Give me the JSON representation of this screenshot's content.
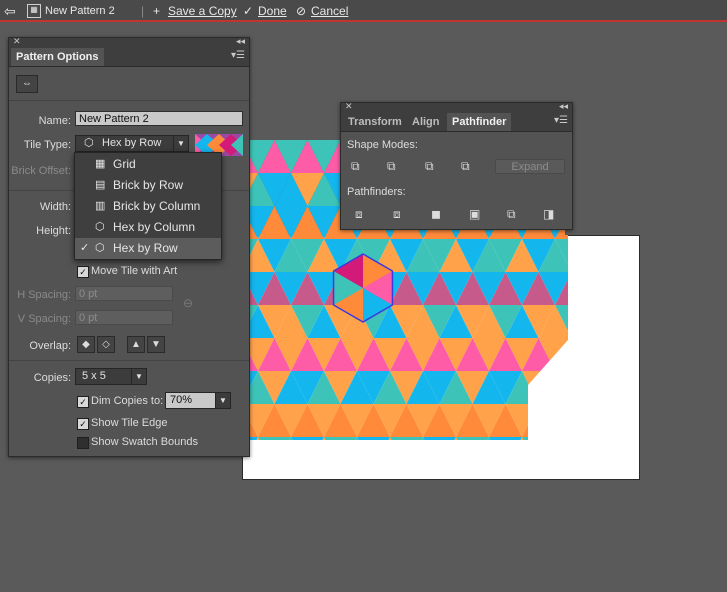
{
  "topbar": {
    "doc_name": "New Pattern 2",
    "save_copy": "Save a Copy",
    "done": "Done",
    "cancel": "Cancel",
    "back_icon": "back-arrow-icon",
    "accent": "#c1342f"
  },
  "pattern_options": {
    "title": "Pattern Options",
    "name_label": "Name:",
    "name_value": "New Pattern 2",
    "tile_type_label": "Tile Type:",
    "tile_type_value": "Hex by Row",
    "brick_offset_label": "Brick Offset:",
    "width_label": "Width:",
    "height_label": "Height:",
    "move_tile": "Move Tile with Art",
    "h_spacing_label": "H Spacing:",
    "h_spacing_value": "0 pt",
    "v_spacing_label": "V Spacing:",
    "v_spacing_value": "0 pt",
    "overlap_label": "Overlap:",
    "copies_label": "Copies:",
    "copies_value": "5 x 5",
    "dim_copies": "Dim Copies to:",
    "dim_value": "70%",
    "show_tile_edge": "Show Tile Edge",
    "show_swatch_bounds": "Show Swatch Bounds",
    "checks": {
      "move_tile": true,
      "dim_copies": true,
      "show_tile_edge": true,
      "show_swatch_bounds": false
    }
  },
  "tile_dropdown": {
    "items": [
      {
        "label": "Grid",
        "icon": "grid-icon",
        "selected": false
      },
      {
        "label": "Brick by Row",
        "icon": "brick-row-icon",
        "selected": false
      },
      {
        "label": "Brick by Column",
        "icon": "brick-column-icon",
        "selected": false
      },
      {
        "label": "Hex by Column",
        "icon": "hex-column-icon",
        "selected": false
      },
      {
        "label": "Hex by Row",
        "icon": "hex-row-icon",
        "selected": true
      }
    ]
  },
  "pathfinder_panel": {
    "tabs": [
      "Transform",
      "Align",
      "Pathfinder"
    ],
    "active_tab": "Pathfinder",
    "shape_modes_label": "Shape Modes:",
    "expand_label": "Expand",
    "pathfinders_label": "Pathfinders:"
  },
  "colors": {
    "pink": "#ff5ca8",
    "magenta": "#d41a78",
    "orange": "#ff8a3a",
    "peach": "#ffa24a",
    "cyan": "#14b6ee",
    "teal": "#3ec3b8",
    "mauve": "#c65a8a",
    "purple": "#9a4aa4"
  }
}
